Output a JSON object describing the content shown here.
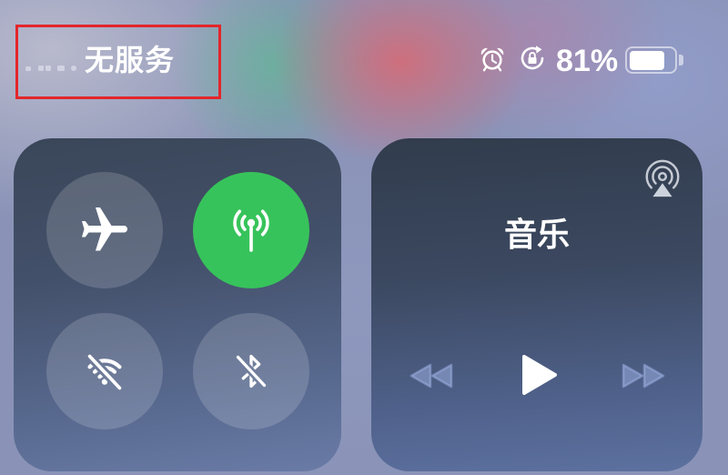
{
  "status_bar": {
    "carrier": "无服务",
    "signal_icon": "signal-indicator-icon",
    "alarm_icon": "alarm-icon",
    "rotation_lock_icon": "rotation-lock-icon",
    "battery_percent": "81%",
    "battery_level": 0.81,
    "battery_icon": "battery-icon"
  },
  "connectivity": {
    "airplane": {
      "icon": "airplane-icon",
      "active": false
    },
    "cellular": {
      "icon": "cellular-antenna-icon",
      "active": true
    },
    "wifi": {
      "icon": "wifi-off-icon",
      "active": false
    },
    "bluetooth": {
      "icon": "bluetooth-off-icon",
      "active": false
    }
  },
  "music": {
    "title": "音乐",
    "airplay_icon": "airplay-icon",
    "controls": {
      "rewind": {
        "icon": "rewind-icon",
        "enabled": false
      },
      "play": {
        "icon": "play-icon",
        "enabled": true
      },
      "forward": {
        "icon": "fast-forward-icon",
        "enabled": false
      }
    }
  },
  "colors": {
    "highlight": "#e3262b",
    "active_green": "#37c35b",
    "inactive_button": "rgba(255,255,255,0.16)",
    "disabled_control": "rgba(160,180,230,0.5)",
    "text": "#ffffff"
  }
}
